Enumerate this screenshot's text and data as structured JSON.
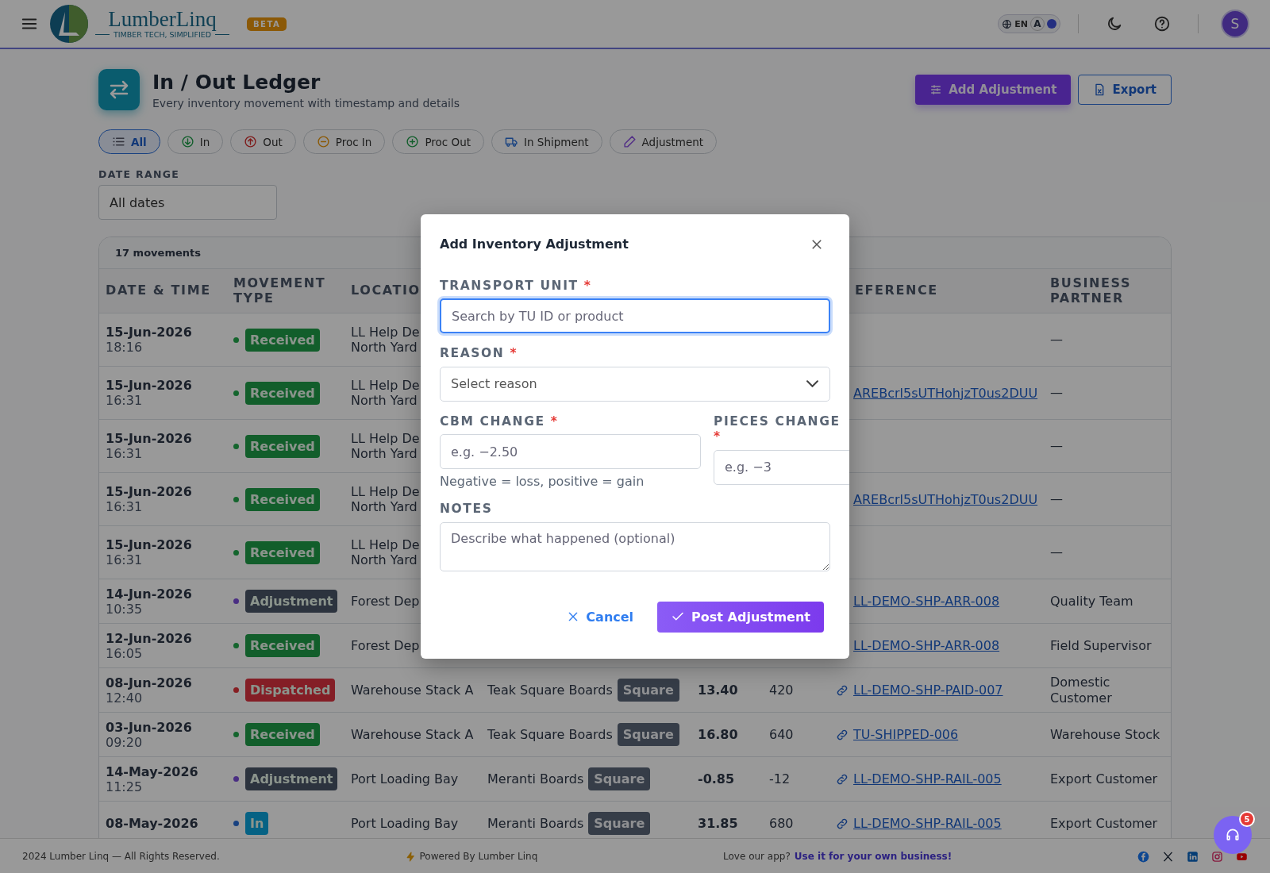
{
  "topbar": {
    "brand": "LumberLinq",
    "tagline": "TIMBER TECH, SIMPLIFIED",
    "beta": "BETA",
    "lang": {
      "code": "EN",
      "alt": "A"
    },
    "avatar": "S"
  },
  "page": {
    "title": "In / Out Ledger",
    "subtitle": "Every inventory movement with timestamp and details",
    "actions": [
      {
        "label": "Add Adjustment",
        "kind": "primary"
      },
      {
        "label": "Export",
        "kind": "outline"
      }
    ]
  },
  "filters": [
    {
      "label": "All",
      "kind": "all",
      "selected": true
    },
    {
      "label": "In",
      "kind": "in",
      "selected": false
    },
    {
      "label": "Out",
      "kind": "out",
      "selected": false
    },
    {
      "label": "Proc In",
      "kind": "proc_in",
      "selected": false
    },
    {
      "label": "Proc Out",
      "kind": "proc_out",
      "selected": false
    },
    {
      "label": "In Shipment",
      "kind": "shipment",
      "selected": false
    },
    {
      "label": "Adjustment",
      "kind": "adjustment",
      "selected": false
    }
  ],
  "date_range": {
    "label": "DATE RANGE",
    "value": "All dates"
  },
  "table": {
    "count": "17 movements",
    "columns": [
      "DATE & TIME",
      "MOVEMENT TYPE",
      "LOCATIO",
      "",
      "",
      "",
      "EFERENCE",
      "BUSINESS PARTNER"
    ],
    "rows": [
      {
        "date": "15-Jun-2026",
        "time": "18:16",
        "type": {
          "label": "Received",
          "kind": "received"
        },
        "location": [
          "LL Help De",
          "North Yard"
        ],
        "partner": "—"
      },
      {
        "date": "15-Jun-2026",
        "time": "16:31",
        "type": {
          "label": "Received",
          "kind": "received"
        },
        "location": [
          "LL Help De",
          "North Yard"
        ],
        "reference": {
          "text": "AREBcrl5sUTHohjzT0us2DUU",
          "link_icon": false
        },
        "partner": "—"
      },
      {
        "date": "15-Jun-2026",
        "time": "16:31",
        "type": {
          "label": "Received",
          "kind": "received"
        },
        "location": [
          "LL Help De",
          "North Yard"
        ],
        "partner": "—"
      },
      {
        "date": "15-Jun-2026",
        "time": "16:31",
        "type": {
          "label": "Received",
          "kind": "received"
        },
        "location": [
          "LL Help De",
          "North Yard"
        ],
        "reference": {
          "text": "AREBcrl5sUTHohjzT0us2DUU",
          "link_icon": false
        },
        "partner": "—"
      },
      {
        "date": "15-Jun-2026",
        "time": "16:31",
        "type": {
          "label": "Received",
          "kind": "received"
        },
        "location": [
          "LL Help De",
          "North Yard"
        ],
        "partner": "—"
      },
      {
        "date": "14-Jun-2026",
        "time": "10:35",
        "type": {
          "label": "Adjustment",
          "kind": "adjustment"
        },
        "location": [
          "Forest Dep"
        ],
        "reference": {
          "text": "LL-DEMO-SHP-ARR-008",
          "link_icon": false
        },
        "partner": "Quality Team"
      },
      {
        "date": "12-Jun-2026",
        "time": "16:05",
        "type": {
          "label": "Received",
          "kind": "received"
        },
        "location": [
          "Forest Dep"
        ],
        "reference": {
          "text": "LL-DEMO-SHP-ARR-008",
          "link_icon": false
        },
        "partner": "Field Supervisor"
      },
      {
        "date": "08-Jun-2026",
        "time": "12:40",
        "type": {
          "label": "Dispatched",
          "kind": "dispatched"
        },
        "location": [
          "Warehouse Stack A"
        ],
        "product": "Teak Square Boards",
        "unit": "Square",
        "cbm": "13.40",
        "pieces": "420",
        "reference": {
          "text": "LL-DEMO-SHP-PAID-007",
          "link_icon": true
        },
        "partner": "Domestic Customer"
      },
      {
        "date": "03-Jun-2026",
        "time": "09:20",
        "type": {
          "label": "Received",
          "kind": "received"
        },
        "location": [
          "Warehouse Stack A"
        ],
        "product": "Teak Square Boards",
        "unit": "Square",
        "cbm": "16.80",
        "pieces": "640",
        "reference": {
          "text": "TU-SHIPPED-006",
          "link_icon": true
        },
        "partner": "Warehouse Stock"
      },
      {
        "date": "14-May-2026",
        "time": "11:25",
        "type": {
          "label": "Adjustment",
          "kind": "adjustment"
        },
        "location": [
          "Port Loading Bay"
        ],
        "product": "Meranti Boards",
        "unit": "Square",
        "cbm": "-0.85",
        "pieces": "-12",
        "reference": {
          "text": "LL-DEMO-SHP-RAIL-005",
          "link_icon": true
        },
        "partner": "Export Customer"
      },
      {
        "date": "08-May-2026",
        "type": {
          "label": "In",
          "kind": "shipment"
        },
        "location": [
          "Port Loading Bay"
        ],
        "product": "Meranti Boards",
        "unit": "Square",
        "cbm": "31.85",
        "pieces": "680",
        "reference": {
          "text": "LL-DEMO-SHP-RAIL-005",
          "link_icon": true
        },
        "partner": "Export Customer"
      }
    ]
  },
  "dialog": {
    "title": "Add Inventory Adjustment",
    "transport_unit": {
      "label": "TRANSPORT UNIT",
      "required_mark": "*",
      "placeholder": "Search by TU ID or product",
      "focused": true
    },
    "reason": {
      "label": "REASON",
      "required_mark": "*",
      "placeholder": "Select reason"
    },
    "cbm_change": {
      "label": "CBM CHANGE",
      "required_mark": "*",
      "placeholder": "e.g. −2.50",
      "hint": "Negative = loss, positive = gain"
    },
    "pieces_change": {
      "label": "PIECES CHANGE",
      "required_mark": "*",
      "placeholder": "e.g. −3"
    },
    "notes": {
      "label": "NOTES",
      "placeholder": "Describe what happened (optional)"
    },
    "cancel": "Cancel",
    "submit": "Post Adjustment"
  },
  "footer": {
    "copyright": "2024 Lumber Linq — All Rights Reserved.",
    "powered": "Powered By Lumber Linq",
    "love": "Love our app?",
    "cta": "Use it for your own business!"
  },
  "support": {
    "badge": "5"
  }
}
